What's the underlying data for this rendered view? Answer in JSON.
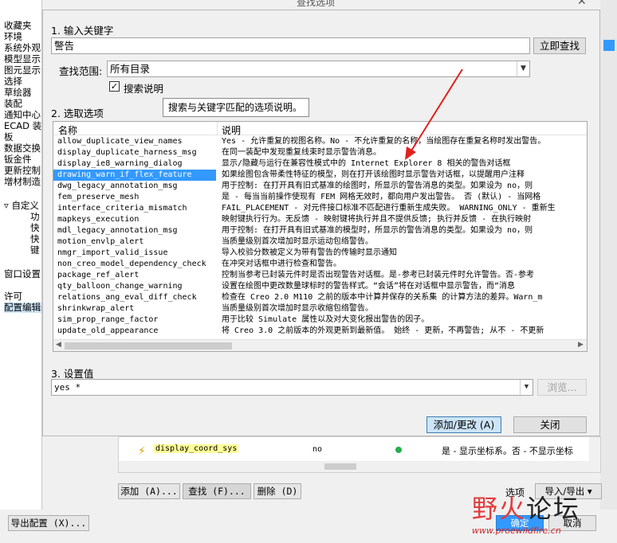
{
  "background": {
    "window_title": "查找选项",
    "left_items": [
      "收藏夹",
      "环境",
      "系统外观",
      "模型显示",
      "图元显示",
      "选择",
      "草绘器",
      "装配",
      "通知中心",
      "ECAD 装配",
      "板",
      "数据交换",
      "钣金件",
      "更新控制",
      "增材制造"
    ],
    "tree_root": "自定义",
    "tree_children": [
      "功",
      "快",
      "快",
      "键"
    ],
    "window_settings": "窗口设置",
    "license": "许可",
    "config_editor": "配置编辑器",
    "export_config_button": "导出配置 (X)...",
    "add_button": "添加 (A)...",
    "find_button": "查找 (F)...",
    "delete_button": "删除 (D)",
    "options_button": "选项",
    "import_export_button": "导入/导出",
    "ok_button": "确定",
    "cancel_button": "取消",
    "table_row": {
      "name": "display_coord_sys",
      "value": "no",
      "desc": "是 - 显示坐标系。否 - 不显示坐标"
    }
  },
  "dialog": {
    "step1_label": "1.  输入关键字",
    "keyword_value": "警告",
    "find_now_button": "立即查找",
    "scope_label": "查找范围:",
    "scope_value": "所有目录",
    "search_desc_checkbox_label": "搜索说明",
    "search_desc_checked": true,
    "tooltip": "搜索与关键字匹配的选项说明。",
    "step2_label": "2.  选取选项",
    "columns": [
      "名称",
      "说明"
    ],
    "rows": [
      {
        "name": "allow_duplicate_view_names",
        "desc": "Yes - 允许重复的视图名称。No - 不允许重复的名称，当绘图存在重复名称时发出警告。",
        "selected": false
      },
      {
        "name": "display_duplicate_harness_msg",
        "desc": "在同一装配中发现重复线束时显示警告消息。",
        "selected": false
      },
      {
        "name": "display_ie8_warning_dialog",
        "desc": "显示/隐藏与运行在兼容性模式中的 Internet Explorer 8 相关的警告对话框",
        "selected": false
      },
      {
        "name": "drawing_warn_if_flex_feature",
        "desc": "如果绘图包含带柔性特征的模型，则在打开该绘图时显示警告对话框，以提醒用户注释",
        "selected": true
      },
      {
        "name": "dwg_legacy_annotation_msg",
        "desc": "用于控制: 在打开具有旧式基准的绘图时，所显示的警告消息的类型。如果设为 no，则",
        "selected": false
      },
      {
        "name": "fem_preserve_mesh",
        "desc": "是 - 每当当前操作使现有 FEM 网格无效时，都向用户发出警告。 否 (默认) - 当网格",
        "selected": false
      },
      {
        "name": "interface_criteria_mismatch",
        "desc": "FAIL_PLACEMENT - 对元件接口标准不匹配进行重新生成失败。 WARNING_ONLY - 重新生",
        "selected": false
      },
      {
        "name": "mapkeys_execution",
        "desc": "映射键执行行为。无反馈 - 映射键将执行并且不提供反馈; 执行并反馈 - 在执行映射",
        "selected": false
      },
      {
        "name": "mdl_legacy_annotation_msg",
        "desc": "用于控制: 在打开具有旧式基准的模型时，所显示的警告消息的类型。如果设为 no，则",
        "selected": false
      },
      {
        "name": "motion_envlp_alert",
        "desc": "当质量级别首次增加时显示运动包络警告。",
        "selected": false
      },
      {
        "name": "nmgr_import_valid_issue",
        "desc": "导入校验分数被定义为带有警告的传输时显示通知",
        "selected": false
      },
      {
        "name": "non_creo_model_dependency_check",
        "desc": "在冲突对话框中进行检查和警告。",
        "selected": false
      },
      {
        "name": "package_ref_alert",
        "desc": "控制当参考已封装元件时是否出现警告对话框。是-参考已封装元件时允许警告。否-参考",
        "selected": false
      },
      {
        "name": "qty_balloon_change_warning",
        "desc": "设置在绘图中更改数量球标时的警告样式。“会话”将在对话框中显示警告，而“消息",
        "selected": false
      },
      {
        "name": "relations_ang_eval_diff_check",
        "desc": "检查在 Creo 2.0 M110 之前的版本中计算并保存的关系集 的计算方法的差异。Warn_m",
        "selected": false
      },
      {
        "name": "shrinkwrap_alert",
        "desc": "当质量级别首次增加时显示收缩包络警告。",
        "selected": false
      },
      {
        "name": "sim_prop_range_factor",
        "desc": "用于比较 Simulate 属性以及对大变化报出警告的因子。",
        "selected": false
      },
      {
        "name": "update_old_appearance",
        "desc": "将 Creo 3.0 之前版本的外观更新到最新值。 始终 - 更新，不再警告; 从不 - 不更新",
        "selected": false
      }
    ],
    "step3_label": "3.  设置值",
    "value_field": "yes *",
    "browse_button": "浏览...",
    "add_change_button": "添加/更改 (A)",
    "close_button": "关闭"
  },
  "watermark": {
    "brand": "野火论坛",
    "brand_red": "野火",
    "brand_dark": "论坛",
    "url": "www.proewildfire.cn"
  },
  "colors": {
    "selection": "#3399ff",
    "arrow": "#e0201e",
    "watermark": "#e23c3c"
  }
}
